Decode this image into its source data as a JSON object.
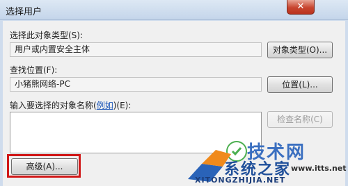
{
  "window": {
    "title": "选择用户",
    "close_glyph": "✕"
  },
  "object_type": {
    "label": "选择此对象类型(S):",
    "value": "用户或内置安全主体",
    "button": "对象类型(O)..."
  },
  "location": {
    "label": "查找位置(F):",
    "value": "小猪熊网络-PC",
    "button": "位置(L)..."
  },
  "names": {
    "label_before": "输入要选择的对象名称(",
    "label_link": "例如",
    "label_after": ")(E):",
    "value": "",
    "check_button": "检查名称(C)"
  },
  "advanced_button": "高级(A)...",
  "watermark": {
    "brand": "技术网",
    "brand2": "系统之家",
    "url": "www.itts.net",
    "bottom": "XITONGZHIJIA.NET",
    "colors": {
      "blue": "#2a63b8",
      "orange": "#f08a1c",
      "green": "#4caf50"
    }
  }
}
